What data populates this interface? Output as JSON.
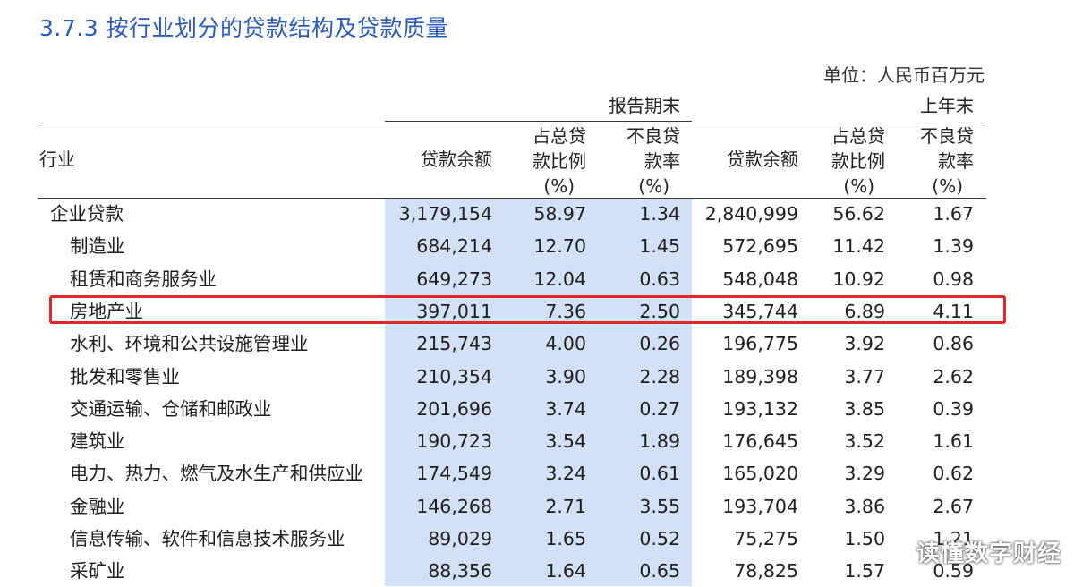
{
  "title": "3.7.3  按行业划分的贷款结构及贷款质量",
  "unit": "单位：人民币百万元",
  "header": {
    "period_current": "报告期末",
    "period_prior": "上年末",
    "industry": "行业",
    "loan_balance": "贷款余额",
    "ratio_line1": "占总贷",
    "ratio_line2": "款比例",
    "npl_line1": "不良贷",
    "npl_line2": "款率",
    "pct": "(%)"
  },
  "rows": [
    {
      "name": "企业贷款",
      "c_bal": "3,179,154",
      "c_ratio": "58.97",
      "c_npl": "1.34",
      "p_bal": "2,840,999",
      "p_ratio": "56.62",
      "p_npl": "1.67"
    },
    {
      "name": "制造业",
      "c_bal": "684,214",
      "c_ratio": "12.70",
      "c_npl": "1.45",
      "p_bal": "572,695",
      "p_ratio": "11.42",
      "p_npl": "1.39"
    },
    {
      "name": "租赁和商务服务业",
      "c_bal": "649,273",
      "c_ratio": "12.04",
      "c_npl": "0.63",
      "p_bal": "548,048",
      "p_ratio": "10.92",
      "p_npl": "0.98"
    },
    {
      "name": "房地产业",
      "c_bal": "397,011",
      "c_ratio": "7.36",
      "c_npl": "2.50",
      "p_bal": "345,744",
      "p_ratio": "6.89",
      "p_npl": "4.11"
    },
    {
      "name": "水利、环境和公共设施管理业",
      "c_bal": "215,743",
      "c_ratio": "4.00",
      "c_npl": "0.26",
      "p_bal": "196,775",
      "p_ratio": "3.92",
      "p_npl": "0.86"
    },
    {
      "name": "批发和零售业",
      "c_bal": "210,354",
      "c_ratio": "3.90",
      "c_npl": "2.28",
      "p_bal": "189,398",
      "p_ratio": "3.77",
      "p_npl": "2.62"
    },
    {
      "name": "交通运输、仓储和邮政业",
      "c_bal": "201,696",
      "c_ratio": "3.74",
      "c_npl": "0.27",
      "p_bal": "193,132",
      "p_ratio": "3.85",
      "p_npl": "0.39"
    },
    {
      "name": "建筑业",
      "c_bal": "190,723",
      "c_ratio": "3.54",
      "c_npl": "1.89",
      "p_bal": "176,645",
      "p_ratio": "3.52",
      "p_npl": "1.61"
    },
    {
      "name": "电力、热力、燃气及水生产和供应业",
      "c_bal": "174,549",
      "c_ratio": "3.24",
      "c_npl": "0.61",
      "p_bal": "165,020",
      "p_ratio": "3.29",
      "p_npl": "0.62"
    },
    {
      "name": "金融业",
      "c_bal": "146,268",
      "c_ratio": "2.71",
      "c_npl": "3.55",
      "p_bal": "193,704",
      "p_ratio": "3.86",
      "p_npl": "2.67"
    },
    {
      "name": "信息传输、软件和信息技术服务业",
      "c_bal": "89,029",
      "c_ratio": "1.65",
      "c_npl": "0.52",
      "p_bal": "75,275",
      "p_ratio": "1.50",
      "p_npl": "1.21"
    },
    {
      "name": "采矿业",
      "c_bal": "88,356",
      "c_ratio": "1.64",
      "c_npl": "0.65",
      "p_bal": "78,825",
      "p_ratio": "1.57",
      "p_npl": "0.59"
    }
  ],
  "watermark": "读懂数字财经",
  "colors": {
    "title": "#2a5ab8",
    "band": "#d2e1f7",
    "highlight": "#e0252b"
  }
}
